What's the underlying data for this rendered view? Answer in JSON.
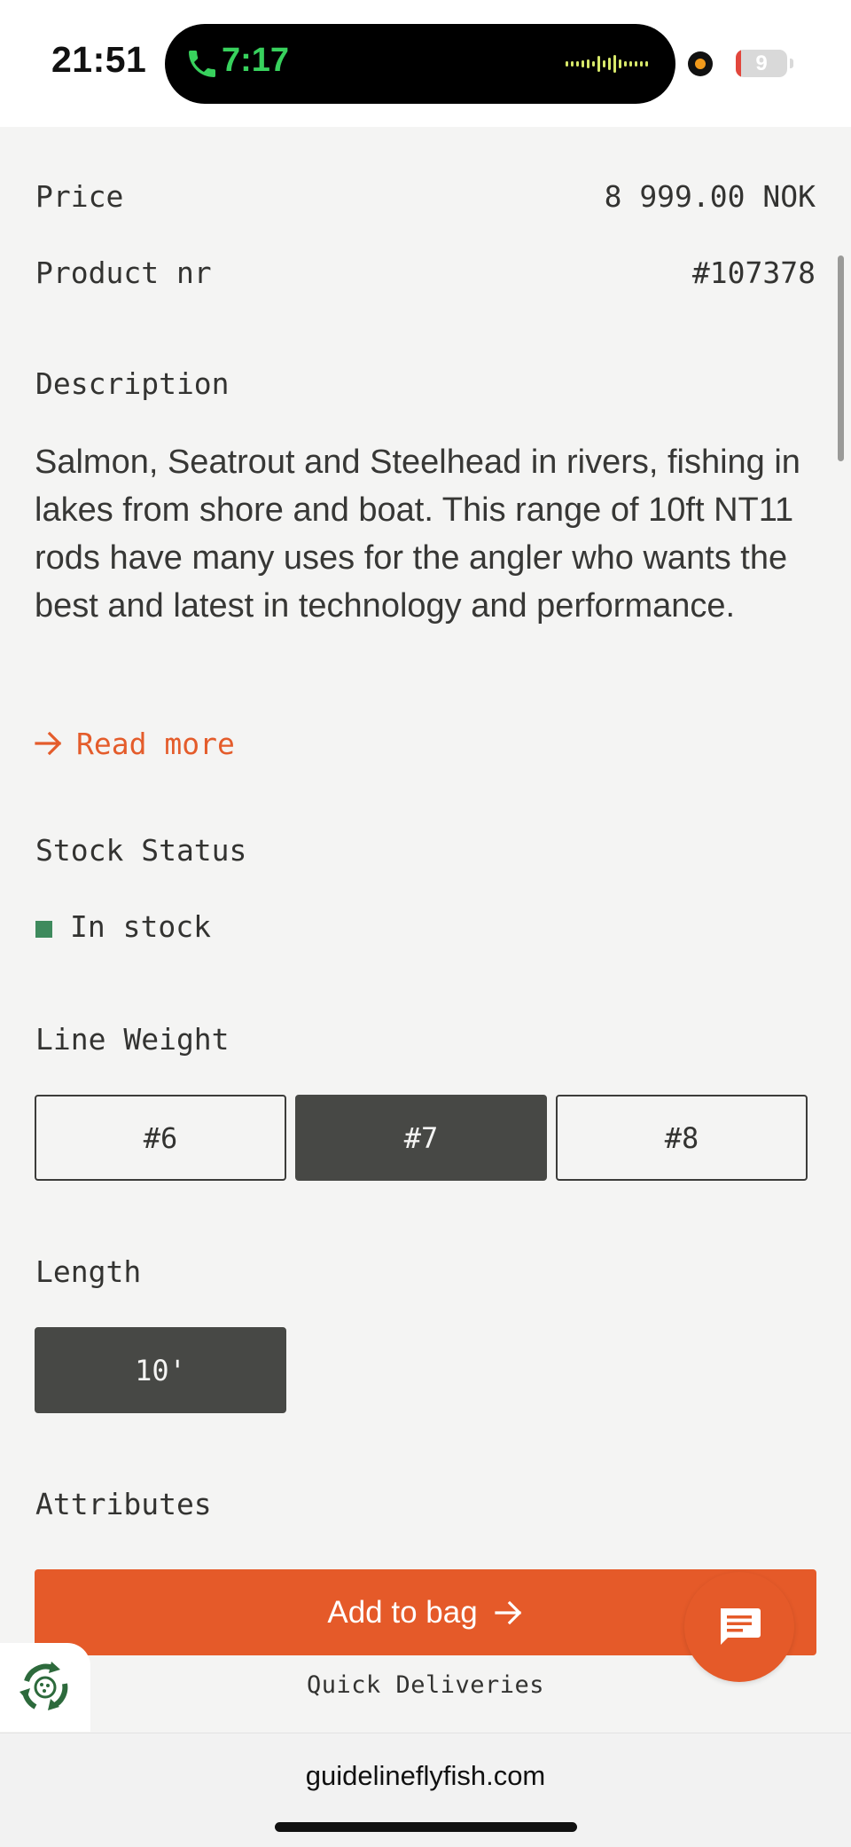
{
  "status_bar": {
    "time": "21:51",
    "call_time": "7:17",
    "battery_level": "9",
    "battery_color": "#e2463c",
    "call_color": "#38d15d",
    "icons": [
      "phone-icon",
      "audio-wave-icon",
      "camera-dot",
      "battery-icon"
    ]
  },
  "product": {
    "price_label": "Price",
    "price_value": "8 999.00 NOK",
    "product_nr_label": "Product nr",
    "product_nr_value": "#107378",
    "description_label": "Description",
    "description_text": "Salmon, Seatrout and Steelhead in rivers, fishing in lakes from shore and boat. This range of 10ft NT11 rods have many uses for the angler who wants the best and latest in technology and performance.",
    "read_more": "Read more",
    "stock_label": "Stock Status",
    "stock_value": "In stock",
    "stock_color": "#3e8a5d",
    "line_weight_label": "Line Weight",
    "line_weights": [
      {
        "label": "#6",
        "selected": false
      },
      {
        "label": "#7",
        "selected": true
      },
      {
        "label": "#8",
        "selected": false
      }
    ],
    "length_label": "Length",
    "lengths": [
      {
        "label": "10'",
        "selected": true
      }
    ],
    "attributes_label": "Attributes"
  },
  "actions": {
    "add_to_bag": "Add to bag",
    "quick_deliveries": "Quick Deliveries",
    "accent_color": "#e55a29"
  },
  "browser": {
    "url": "guidelineflyfish.com"
  }
}
